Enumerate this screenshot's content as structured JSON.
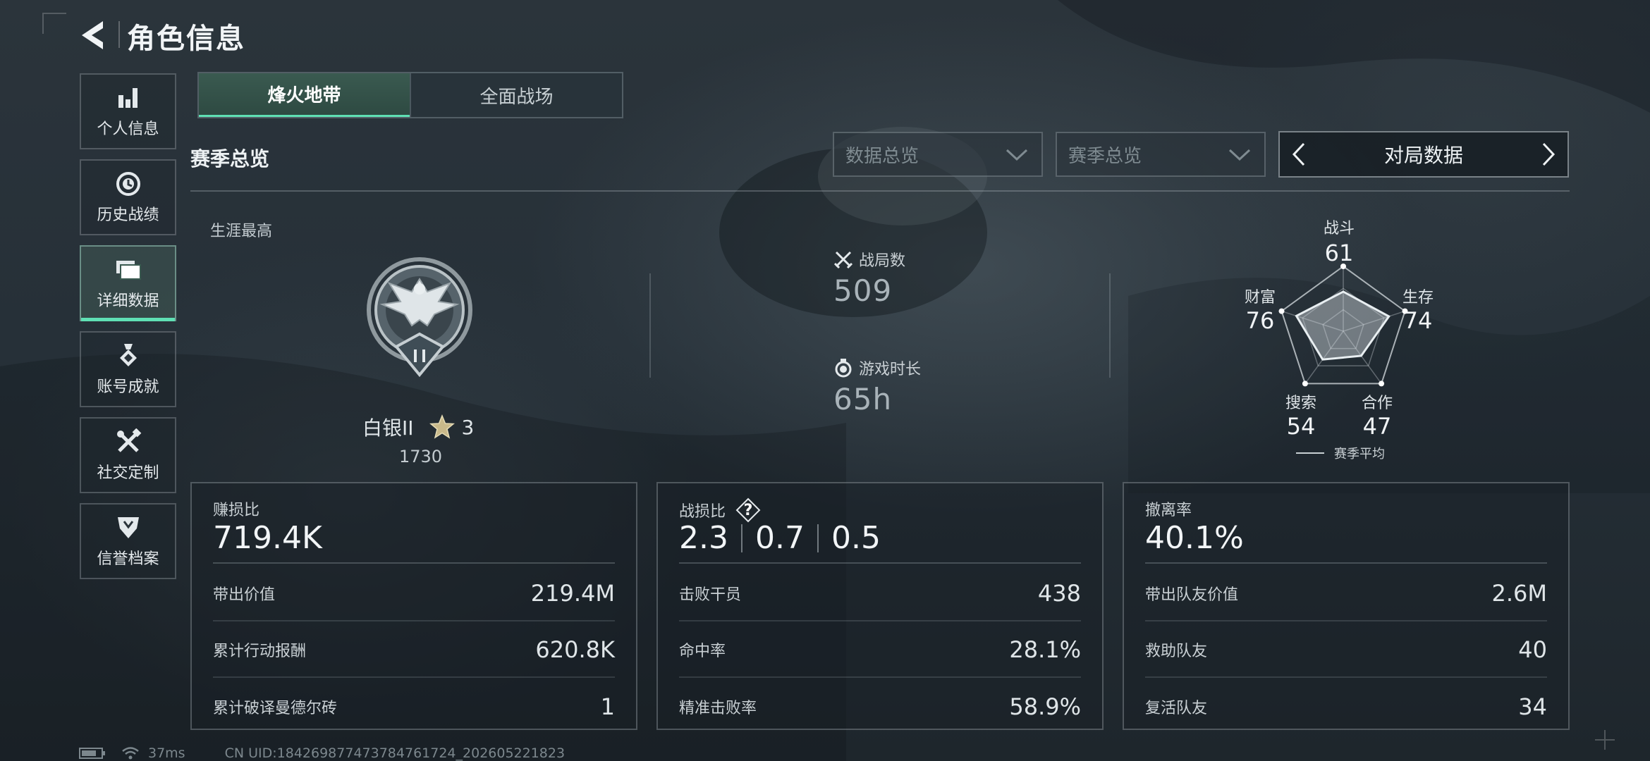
{
  "header": {
    "title": "角色信息",
    "back_icon": "back-arrow-icon"
  },
  "sidebar": {
    "items": [
      {
        "label": "个人信息",
        "icon": "bar-chart-icon",
        "active": false
      },
      {
        "label": "历史战绩",
        "icon": "clock-icon",
        "active": false
      },
      {
        "label": "详细数据",
        "icon": "folder-icon",
        "active": true
      },
      {
        "label": "账号成就",
        "icon": "medal-icon",
        "active": false
      },
      {
        "label": "社交定制",
        "icon": "tools-icon",
        "active": false
      },
      {
        "label": "信誉档案",
        "icon": "shield-icon",
        "active": false
      }
    ]
  },
  "mode_tabs": [
    {
      "label": "烽火地带",
      "active": true
    },
    {
      "label": "全面战场",
      "active": false
    }
  ],
  "section_title": "赛季总览",
  "filters": {
    "data_scope": "数据总览",
    "season_scope": "赛季总览",
    "data_switch": "对局数据"
  },
  "overview": {
    "career_label": "生涯最高",
    "rank_name": "白银II",
    "rank_stars": "3",
    "rank_score": "1730",
    "matches_label": "战局数",
    "matches_value": "509",
    "playtime_label": "游戏时长",
    "playtime_value": "65h"
  },
  "radar": {
    "axes": [
      {
        "label": "战斗",
        "value": "61"
      },
      {
        "label": "生存",
        "value": "74"
      },
      {
        "label": "合作",
        "value": "47"
      },
      {
        "label": "搜索",
        "value": "54"
      },
      {
        "label": "财富",
        "value": "76"
      }
    ],
    "legend": "赛季平均"
  },
  "cards": [
    {
      "title": "赚损比",
      "main": "719.4K",
      "rows": [
        {
          "label": "带出价值",
          "value": "219.4M"
        },
        {
          "label": "累计行动报酬",
          "value": "620.8K"
        },
        {
          "label": "累计破译曼德尔砖",
          "value": "1"
        }
      ]
    },
    {
      "title": "战损比",
      "help": "?",
      "main_parts": [
        "2.3",
        "0.7",
        "0.5"
      ],
      "rows": [
        {
          "label": "击败干员",
          "value": "438"
        },
        {
          "label": "命中率",
          "value": "28.1%"
        },
        {
          "label": "精准击败率",
          "value": "58.9%"
        }
      ]
    },
    {
      "title": "撤离率",
      "main": "40.1%",
      "rows": [
        {
          "label": "带出队友价值",
          "value": "2.6M"
        },
        {
          "label": "救助队友",
          "value": "40"
        },
        {
          "label": "复活队友",
          "value": "34"
        }
      ]
    }
  ],
  "footer": {
    "ping": "37ms",
    "uid": "CN UID:1842698774737847617​24_202605221823"
  },
  "colors": {
    "accent": "#5fe0b4",
    "background": "#263038"
  }
}
